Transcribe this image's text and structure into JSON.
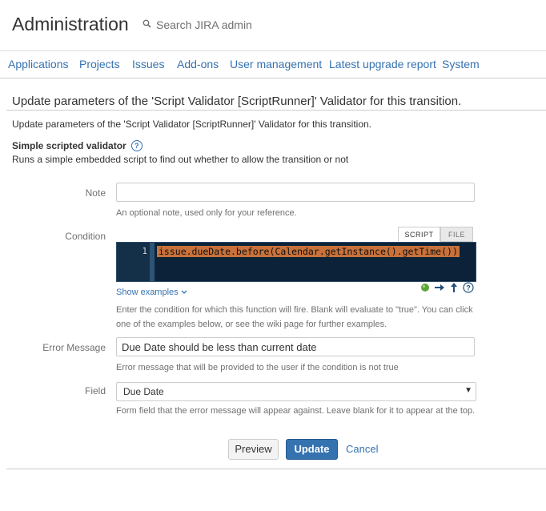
{
  "header": {
    "title": "Administration",
    "search_placeholder": "Search JIRA admin"
  },
  "nav": {
    "items": [
      {
        "label": "Applications"
      },
      {
        "label": "Projects"
      },
      {
        "label": "Issues"
      },
      {
        "label": "Add-ons"
      },
      {
        "label": "User management"
      },
      {
        "label": "Latest upgrade report"
      },
      {
        "label": "System"
      }
    ]
  },
  "page": {
    "heading": "Update parameters of the 'Script Validator [ScriptRunner]' Validator for this transition.",
    "description": "Update parameters of the 'Script Validator [ScriptRunner]' Validator for this transition.",
    "section_title": "Simple scripted validator",
    "section_desc": "Runs a simple embedded script to find out whether to allow the transition or not"
  },
  "form": {
    "note": {
      "label": "Note",
      "value": "",
      "hint": "An optional note, used only for your reference."
    },
    "condition": {
      "label": "Condition",
      "tabs": [
        "SCRIPT",
        "FILE"
      ],
      "active_tab": "SCRIPT",
      "line_number": "1",
      "code": "issue.dueDate.before(Calendar.getInstance().getTime())",
      "show_examples": "Show examples",
      "hint_line1": "Enter the condition for which this function will fire. Blank will evaluate to \"true\". You can click",
      "hint_line2": "one of the examples below, or see the wiki page for further examples."
    },
    "error_message": {
      "label": "Error Message",
      "value": "Due Date should be less than current date",
      "hint": "Error message that will be provided to the user if the condition is not true"
    },
    "field": {
      "label": "Field",
      "selected": "Due Date",
      "hint": "Form field that the error message will appear against. Leave blank for it to appear at the top."
    }
  },
  "actions": {
    "preview": "Preview",
    "update": "Update",
    "cancel": "Cancel"
  },
  "colors": {
    "link": "#3572b0",
    "primary_button": "#3572b0",
    "editor_bg": "#0b2238",
    "code_highlight": "#c8713a"
  },
  "icons": {
    "search": "search-icon",
    "help": "help-icon",
    "chevron": "chevron-down-icon",
    "run": "green-dot-icon",
    "next": "arrow-right-icon",
    "up": "arrow-up-icon",
    "info": "question-icon"
  }
}
